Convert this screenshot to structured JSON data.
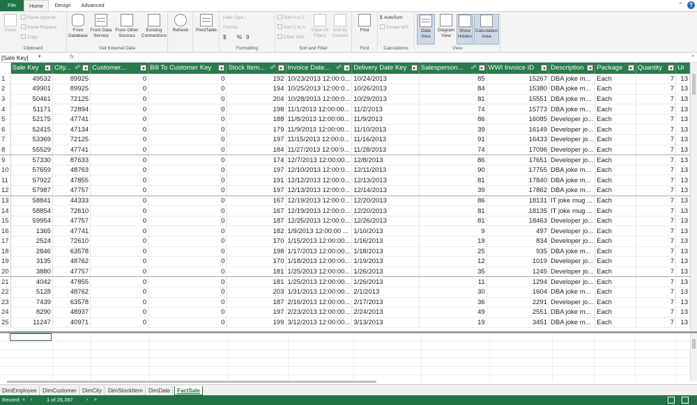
{
  "ribbon_tabs": [
    "File",
    "Home",
    "Design",
    "Advanced"
  ],
  "ribbon": {
    "clipboard": {
      "label": "Clipboard",
      "paste": "Paste",
      "paste_append": "Paste Append",
      "paste_replace": "Paste Replace",
      "copy": "Copy"
    },
    "external": {
      "label": "Get External Data",
      "from_database": "From\nDatabase",
      "from_data_service": "From Data\nService",
      "from_other_sources": "From Other\nSources",
      "existing_connections": "Existing\nConnections"
    },
    "refresh": "Refresh",
    "pivottable": "PivotTable",
    "formatting": {
      "label": "Formatting",
      "data_type": "Data Type :",
      "format": "Format :",
      "currency": "$",
      "percent": "%",
      "comma": "9"
    },
    "sort": {
      "label": "Sort and Filter",
      "sort_az": "Sort A to Z",
      "sort_za": "Sort Z to A",
      "clear_sort": "Clear Sort",
      "clear_all_filters": "Clear All\nFilters",
      "sort_by_column": "Sort by\nColumn"
    },
    "find": {
      "label": "Find",
      "find": "Find"
    },
    "calculations": {
      "label": "Calculations",
      "autosum": "AutoSum",
      "create_kpi": "Create KPI"
    },
    "view": {
      "label": "View",
      "data_view": "Data\nView",
      "diagram_view": "Diagram\nView",
      "show_hidden": "Show\nHidden",
      "calculation_area": "Calculation\nArea"
    }
  },
  "formula_bar": {
    "name_box": "[Sale Key]",
    "fx": "fx"
  },
  "columns": [
    "Sale Key",
    "City...",
    "Customer...",
    "Bill To Customer Key",
    "Stock Item...",
    "Invoice Date...",
    "Delivery Date Key",
    "Salesperson...",
    "WWI Invoice ID",
    "Description",
    "Package",
    "Quantity",
    "Ur"
  ],
  "rows": [
    [
      "1",
      "49532",
      "89925",
      "0",
      "0",
      "192",
      "10/23/2013 12:00:0...",
      "10/24/2013",
      "85",
      "15267",
      "DBA joke m...",
      "Each",
      "7",
      "13"
    ],
    [
      "2",
      "49901",
      "89925",
      "0",
      "0",
      "194",
      "10/25/2013 12:00:0...",
      "10/26/2013",
      "84",
      "15380",
      "DBA joke m...",
      "Each",
      "7",
      "13"
    ],
    [
      "3",
      "50461",
      "72125",
      "0",
      "0",
      "204",
      "10/28/2013 12:00:0...",
      "10/29/2013",
      "81",
      "15551",
      "DBA joke m...",
      "Each",
      "7",
      "13"
    ],
    [
      "4",
      "51171",
      "72894",
      "0",
      "0",
      "198",
      "11/1/2013 12:00:00...",
      "11/2/2013",
      "74",
      "15773",
      "DBA joke m...",
      "Each",
      "7",
      "13"
    ],
    [
      "5",
      "52175",
      "47741",
      "0",
      "0",
      "188",
      "11/8/2013 12:00:00...",
      "11/9/2013",
      "86",
      "16085",
      "Developer jo...",
      "Each",
      "7",
      "13"
    ],
    [
      "6",
      "52415",
      "47134",
      "0",
      "0",
      "179",
      "11/9/2013 12:00:00...",
      "11/10/2013",
      "39",
      "16149",
      "Developer jo...",
      "Each",
      "7",
      "13"
    ],
    [
      "7",
      "53369",
      "72125",
      "0",
      "0",
      "197",
      "11/15/2013 12:00:0...",
      "11/16/2013",
      "91",
      "16433",
      "Developer jo...",
      "Each",
      "7",
      "13"
    ],
    [
      "8",
      "55529",
      "47741",
      "0",
      "0",
      "184",
      "11/27/2013 12:00:0...",
      "11/28/2013",
      "74",
      "17096",
      "Developer jo...",
      "Each",
      "7",
      "13"
    ],
    [
      "9",
      "57330",
      "87633",
      "0",
      "0",
      "174",
      "12/7/2013 12:00:00...",
      "12/8/2013",
      "86",
      "17651",
      "Developer jo...",
      "Each",
      "7",
      "13"
    ],
    [
      "10",
      "57659",
      "48763",
      "0",
      "0",
      "197",
      "12/10/2013 12:00:0...",
      "12/11/2013",
      "90",
      "17755",
      "DBA joke m...",
      "Each",
      "7",
      "13"
    ],
    [
      "11",
      "57922",
      "47855",
      "0",
      "0",
      "191",
      "12/12/2013 12:00:0...",
      "12/13/2013",
      "81",
      "17840",
      "DBA joke m...",
      "Each",
      "7",
      "13"
    ],
    [
      "12",
      "57987",
      "47757",
      "0",
      "0",
      "197",
      "12/13/2013 12:00:0...",
      "12/14/2013",
      "39",
      "17862",
      "DBA joke m...",
      "Each",
      "7",
      "13"
    ],
    [
      "13",
      "58841",
      "44333",
      "0",
      "0",
      "167",
      "12/19/2013 12:00:0...",
      "12/20/2013",
      "86",
      "18131",
      "IT joke mug ...",
      "Each",
      "7",
      "13"
    ],
    [
      "14",
      "58854",
      "72610",
      "0",
      "0",
      "167",
      "12/19/2013 12:00:0...",
      "12/20/2013",
      "81",
      "18135",
      "IT joke mug ...",
      "Each",
      "7",
      "13"
    ],
    [
      "15",
      "59954",
      "47757",
      "0",
      "0",
      "187",
      "12/25/2013 12:00:0...",
      "12/26/2013",
      "81",
      "18463",
      "Developer jo...",
      "Each",
      "7",
      "13"
    ],
    [
      "16",
      "1365",
      "47741",
      "0",
      "0",
      "182",
      "1/9/2013 12:00:00 ...",
      "1/10/2013",
      "9",
      "497",
      "Developer jo...",
      "Each",
      "7",
      "13"
    ],
    [
      "17",
      "2524",
      "72610",
      "0",
      "0",
      "170",
      "1/15/2013 12:00:00...",
      "1/16/2013",
      "19",
      "834",
      "Developer jo...",
      "Each",
      "7",
      "13"
    ],
    [
      "18",
      "2846",
      "63578",
      "0",
      "0",
      "198",
      "1/17/2013 12:00:00...",
      "1/18/2013",
      "25",
      "935",
      "DBA joke m...",
      "Each",
      "7",
      "13"
    ],
    [
      "19",
      "3135",
      "48762",
      "0",
      "0",
      "170",
      "1/18/2013 12:00:00...",
      "1/19/2013",
      "12",
      "1019",
      "Developer jo...",
      "Each",
      "7",
      "13"
    ],
    [
      "20",
      "3880",
      "47757",
      "0",
      "0",
      "181",
      "1/25/2013 12:00:00...",
      "1/26/2013",
      "35",
      "1245",
      "Developer jo...",
      "Each",
      "7",
      "13"
    ],
    [
      "21",
      "4042",
      "47855",
      "0",
      "0",
      "181",
      "1/25/2013 12:00:00...",
      "1/26/2013",
      "11",
      "1294",
      "Developer jo...",
      "Each",
      "7",
      "13"
    ],
    [
      "22",
      "5128",
      "48762",
      "0",
      "0",
      "203",
      "1/31/2013 12:00:00...",
      "2/1/2013",
      "30",
      "1604",
      "DBA joke m...",
      "Each",
      "7",
      "13"
    ],
    [
      "23",
      "7439",
      "63578",
      "0",
      "0",
      "187",
      "2/16/2013 12:00:00...",
      "2/17/2013",
      "36",
      "2291",
      "Developer jo...",
      "Each",
      "7",
      "13"
    ],
    [
      "24",
      "8290",
      "48937",
      "0",
      "0",
      "197",
      "2/23/2013 12:00:00...",
      "2/24/2013",
      "49",
      "2551",
      "DBA joke m...",
      "Each",
      "7",
      "13"
    ],
    [
      "25",
      "11247",
      "40971",
      "0",
      "0",
      "199",
      "3/12/2013 12:00:00...",
      "3/13/2013",
      "19",
      "3451",
      "DBA joke m...",
      "Each",
      "7",
      "13"
    ]
  ],
  "sheet_tabs": [
    "DimEmployee",
    "DimCustomer",
    "DimCity",
    "DimStockItem",
    "DimDate",
    "FactSale"
  ],
  "active_sheet": "FactSale",
  "status": {
    "record_label": "Record:",
    "nav_first": "«",
    "nav_prev": "‹",
    "record_of": "1 of 26,397",
    "nav_next": "›",
    "nav_last": "»"
  },
  "colors": {
    "accent": "#217346",
    "header": "#2a7a4e"
  }
}
